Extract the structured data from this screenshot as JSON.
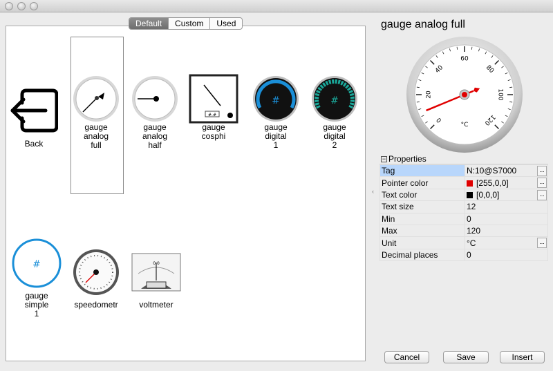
{
  "tabs": [
    "Default",
    "Custom",
    "Used"
  ],
  "active_tab": "Default",
  "items": {
    "back": "Back",
    "gauge_analog_full": [
      "gauge",
      "analog",
      "full"
    ],
    "gauge_analog_half": [
      "gauge",
      "analog",
      "half"
    ],
    "gauge_cosphi": [
      "gauge",
      "cosphi"
    ],
    "gauge_digital_1": [
      "gauge",
      "digital",
      "1"
    ],
    "gauge_digital_2": [
      "gauge",
      "digital",
      "2"
    ],
    "gauge_simple_1": [
      "gauge",
      "simple",
      "1"
    ],
    "speedometr": "speedometr",
    "voltmeter": "voltmeter"
  },
  "thumb_text": {
    "hash": "#",
    "cosphi_display": "#.#",
    "voltmeter_value": "0.0"
  },
  "preview": {
    "title": "gauge analog full",
    "ticks": [
      "0",
      "20",
      "40",
      "60",
      "80",
      "100",
      "120"
    ],
    "unit": "°C",
    "pointer_value": 10
  },
  "properties": {
    "header": "Properties",
    "collapse_glyph": "−",
    "rows": [
      {
        "name": "Tag",
        "value": "N:10@S7000",
        "ellipsis": "..."
      },
      {
        "name": "Pointer color",
        "value": "[255,0,0]",
        "swatch": "#e00000",
        "ellipsis": "..."
      },
      {
        "name": "Text color",
        "value": "[0,0,0]",
        "swatch": "#000000",
        "ellipsis": "..."
      },
      {
        "name": "Text size",
        "value": "12"
      },
      {
        "name": "Min",
        "value": "0"
      },
      {
        "name": "Max",
        "value": "120"
      },
      {
        "name": "Unit",
        "value": "°C",
        "ellipsis": "..."
      },
      {
        "name": "Decimal places",
        "value": "0"
      }
    ]
  },
  "buttons": {
    "cancel": "Cancel",
    "save": "Save",
    "insert": "Insert"
  },
  "splitter_glyph": "‹",
  "colors": {
    "pointer": "#e00000",
    "digital_blue": "#1a8fd8",
    "digital_teal": "#1aa89a",
    "selection": "#b8d6fb"
  }
}
